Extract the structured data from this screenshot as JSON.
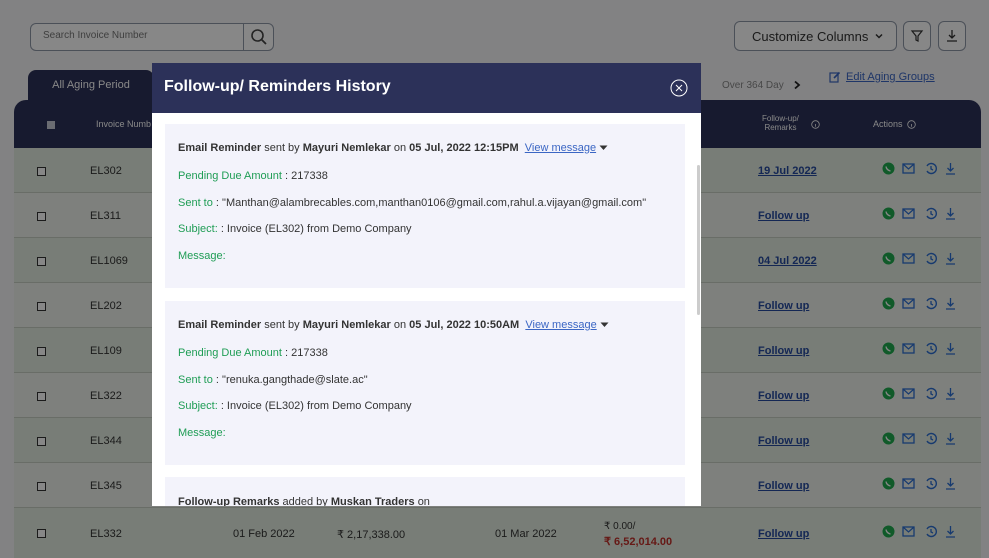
{
  "toolbar": {
    "search_placeholder": "Search Invoice Number",
    "customize_columns": "Customize Columns"
  },
  "tabs": {
    "active": "All Aging Period",
    "visible_last": "Over 364 Day",
    "edit_aging": "Edit Aging Groups"
  },
  "table": {
    "headers": {
      "invoice": "Invoice Numb",
      "followup_line1": "Follow-up/",
      "followup_line2": "Remarks",
      "actions": "Actions"
    },
    "rows": [
      {
        "invoice": "EL302",
        "followup": "19 Jul 2022"
      },
      {
        "invoice": "EL311",
        "followup": "Follow up"
      },
      {
        "invoice": "EL1069",
        "followup": "04 Jul 2022"
      },
      {
        "invoice": "EL202",
        "followup": "Follow up"
      },
      {
        "invoice": "EL109",
        "followup": "Follow up"
      },
      {
        "invoice": "EL322",
        "followup": "Follow up"
      },
      {
        "invoice": "EL344",
        "followup": "Follow up"
      },
      {
        "invoice": "EL345",
        "followup": "Follow up"
      }
    ],
    "last_row": {
      "invoice": "EL332",
      "invoice_date": "01 Feb 2022",
      "amount": "₹ 2,17,338.00",
      "due_date": "01 Mar 2022",
      "paid": "₹ 0.00/",
      "due": "₹ 6,52,014.00",
      "followup": "Follow up"
    }
  },
  "modal": {
    "title": "Follow-up/ Reminders History",
    "entries": [
      {
        "type": "Email Reminder",
        "sent_by_text": "sent by",
        "sender": "Mayuri Nemlekar",
        "on_text": "on",
        "datetime": "05 Jul, 2022 12:15PM",
        "view_message": "View message",
        "pending_label": "Pending Due Amount",
        "pending_value": ": 217338",
        "sent_to_label": "Sent to",
        "sent_to_value": ": \"Manthan@alambrecables.com,manthan0106@gmail.com,rahul.a.vijayan@gmail.com\"",
        "subject_label": "Subject:",
        "subject_value": ": Invoice (EL302) from Demo Company",
        "message_label": "Message:"
      },
      {
        "type": "Email Reminder",
        "sent_by_text": "sent by",
        "sender": "Mayuri Nemlekar",
        "on_text": "on",
        "datetime": "05 Jul, 2022 10:50AM",
        "view_message": "View message",
        "pending_label": "Pending Due Amount",
        "pending_value": ": 217338",
        "sent_to_label": "Sent to",
        "sent_to_value": ": \"renuka.gangthade@slate.ac\"",
        "subject_label": "Subject:",
        "subject_value": ": Invoice (EL302) from Demo Company",
        "message_label": "Message:"
      }
    ],
    "remark": {
      "type": "Follow-up Remarks",
      "added_by_text": "added by",
      "author": "Muskan Traders",
      "on_text": "on"
    }
  },
  "colors": {
    "navy": "#2c3159",
    "green": "#1f9d55",
    "link": "#3b66c4",
    "due_red": "#c0302a"
  }
}
